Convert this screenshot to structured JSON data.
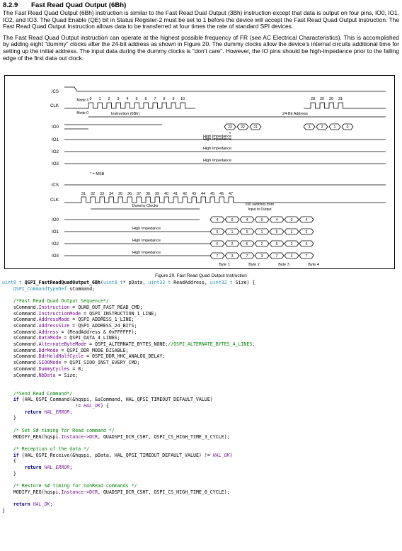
{
  "section": {
    "number": "8.2.9",
    "title": "Fast Read Quad Output (6Bh)",
    "para1": "The Fast Read Quad Output (6Bh) instruction is similar to the Fast Read Dual Output (3Bh) instruction except that data is output on four pins, IO0, IO1, IO2, and IO3. The Quad Enable (QE) bit in Status Register-2 must be set to 1 before the device will accept the Fast Read Quad Output Instruction. The Fast Read Quad Output Instruction allows data to be transferred at four times the rate of standard SPI devices.",
    "para2": "The Fast Read Quad Output instruction can operate at the highest possible frequency of FR (see AC Electrical Characteristics). This is accomplished by adding eight \"dummy\" clocks after the 24-bit address as shown in Figure 20. The dummy clocks allow the device's internal circuits additional time for setting up the initial address. The input data during the dummy clocks is \"don't care\". However, the IO pins should be high-impedance prior to the falling edge of the first data out clock."
  },
  "figure": {
    "caption": "Figure 20. Fast Read Quad Output Instruction",
    "top": {
      "signals": [
        "/CS",
        "CLK",
        "IO0",
        "IO1",
        "IO2",
        "IO3"
      ],
      "mode3": "Mode 3",
      "mode0": "Mode 0",
      "clock_numbers": [
        "0",
        "1",
        "2",
        "3",
        "4",
        "5",
        "6",
        "7",
        "8",
        "9",
        "10",
        "28",
        "29",
        "30",
        "31"
      ],
      "instruction_label": "Instruction (6Bh)",
      "address_label": "24-Bit Address",
      "address_bits": [
        "23",
        "22",
        "21",
        "3",
        "2",
        "1",
        "0"
      ],
      "high_impedance": "High Impedance",
      "msb_note": "* = MSB"
    },
    "bottom": {
      "signals": [
        "/CS",
        "CLK",
        "IO0",
        "IO1",
        "IO2",
        "IO3"
      ],
      "clock_numbers": [
        "31",
        "32",
        "33",
        "34",
        "35",
        "36",
        "37",
        "38",
        "39",
        "40",
        "41",
        "42",
        "43",
        "44",
        "45",
        "46",
        "47"
      ],
      "dummy_label": "Dummy Clocks",
      "switch_label_1": "IO0 switches from",
      "switch_label_2": "Input to Output",
      "high_impedance": "High Impedance",
      "io0_vals": [
        "4",
        "0",
        "4",
        "0",
        "4",
        "0",
        "4"
      ],
      "io1_vals": [
        "5",
        "1",
        "5",
        "1",
        "5",
        "1",
        "5"
      ],
      "io2_vals": [
        "6",
        "2",
        "6",
        "2",
        "6",
        "2",
        "6"
      ],
      "io3_vals": [
        "7",
        "3",
        "7",
        "3",
        "7",
        "3",
        "7"
      ],
      "bytes": [
        "Byte 1",
        "Byte 2",
        "Byte 3",
        "Byte 4"
      ]
    }
  },
  "code": [
    {
      "t": "uint8_t ",
      "c": "ty"
    },
    {
      "t": "QSPI_FastReadQuadOutput_6Bh",
      "c": "fn"
    },
    {
      "t": "(",
      "c": "nm"
    },
    {
      "t": "uint8_t",
      "c": "ty"
    },
    {
      "t": "* pData, ",
      "c": "nm"
    },
    {
      "t": "uint32_t",
      "c": "ty"
    },
    {
      "t": " ReadAddress, ",
      "c": "nm"
    },
    {
      "t": "uint32_t",
      "c": "ty"
    },
    {
      "t": " Size) {\n",
      "c": "nm"
    },
    {
      "t": "    ",
      "c": "nm"
    },
    {
      "t": "QSPI_CommandTypeDef",
      "c": "ty"
    },
    {
      "t": " sCommand;\n\n",
      "c": "nm"
    },
    {
      "t": "    /*Fast Read Quad Output Sequence*/\n",
      "c": "cm"
    },
    {
      "t": "    sCommand.",
      "c": "nm"
    },
    {
      "t": "Instruction",
      "c": "mem"
    },
    {
      "t": " = QUAD_OUT_FAST_READ_CMD;\n",
      "c": "nm"
    },
    {
      "t": "    sCommand.",
      "c": "nm"
    },
    {
      "t": "InstructionMode",
      "c": "mem"
    },
    {
      "t": " = QSPI_INSTRUCTION_1_LINE;\n",
      "c": "nm"
    },
    {
      "t": "    sCommand.",
      "c": "nm"
    },
    {
      "t": "AddressMode",
      "c": "mem"
    },
    {
      "t": " = QSPI_ADDRESS_1_LINE;\n",
      "c": "nm"
    },
    {
      "t": "    sCommand.",
      "c": "nm"
    },
    {
      "t": "AddressSize",
      "c": "mem"
    },
    {
      "t": " = QSPI_ADDRESS_24_BITS;\n",
      "c": "nm"
    },
    {
      "t": "    sCommand.",
      "c": "nm"
    },
    {
      "t": "Address",
      "c": "mem"
    },
    {
      "t": " = (ReadAddress & 0xFFFFFF);\n",
      "c": "nm"
    },
    {
      "t": "    sCommand.",
      "c": "nm"
    },
    {
      "t": "DataMode",
      "c": "mem"
    },
    {
      "t": " = QSPI_DATA_4_LINES;\n",
      "c": "nm"
    },
    {
      "t": "    sCommand.",
      "c": "nm"
    },
    {
      "t": "AlternateByteMode",
      "c": "mem"
    },
    {
      "t": " = QSPI_ALTERNATE_BYTES_NONE;",
      "c": "nm"
    },
    {
      "t": "//QSPI_ALTERNATE_BYTES_4_LINES;\n",
      "c": "cm"
    },
    {
      "t": "    sCommand.",
      "c": "nm"
    },
    {
      "t": "DdrMode",
      "c": "mem"
    },
    {
      "t": " = QSPI_DDR_MODE_DISABLE;\n",
      "c": "nm"
    },
    {
      "t": "    sCommand.",
      "c": "nm"
    },
    {
      "t": "DdrHoldHalfCycle",
      "c": "mem"
    },
    {
      "t": " = QSPI_DDR_HHC_ANALOG_DELAY;\n",
      "c": "nm"
    },
    {
      "t": "    sCommand.",
      "c": "nm"
    },
    {
      "t": "SIOOMode",
      "c": "mem"
    },
    {
      "t": " = QSPI_SIOO_INST_EVERY_CMD;\n",
      "c": "nm"
    },
    {
      "t": "    sCommand.",
      "c": "nm"
    },
    {
      "t": "DummyCycles",
      "c": "mem"
    },
    {
      "t": " = 8;\n",
      "c": "nm"
    },
    {
      "t": "    sCommand.",
      "c": "nm"
    },
    {
      "t": "NbData",
      "c": "mem"
    },
    {
      "t": " = Size;\n\n\n",
      "c": "nm"
    },
    {
      "t": "    /*Send Read Command*/\n",
      "c": "cm"
    },
    {
      "t": "    ",
      "c": "nm"
    },
    {
      "t": "if",
      "c": "kw"
    },
    {
      "t": " (HAL_QSPI_Command(&hqspi, &sCommand, HAL_QPSI_TIMEOUT_DEFAULT_VALUE)\n",
      "c": "nm"
    },
    {
      "t": "                          != ",
      "c": "nm"
    },
    {
      "t": "HAL_OK",
      "c": "en"
    },
    {
      "t": ") {\n",
      "c": "nm"
    },
    {
      "t": "        ",
      "c": "nm"
    },
    {
      "t": "return",
      "c": "kw"
    },
    {
      "t": " ",
      "c": "nm"
    },
    {
      "t": "HAL_ERROR",
      "c": "en"
    },
    {
      "t": ";\n",
      "c": "nm"
    },
    {
      "t": "    }\n\n",
      "c": "nm"
    },
    {
      "t": "    /* Set S# timing for Read command */\n",
      "c": "cm"
    },
    {
      "t": "    MODIFY_REG(hqspi.",
      "c": "nm"
    },
    {
      "t": "Instance",
      "c": "mem"
    },
    {
      "t": "->",
      "c": "nm"
    },
    {
      "t": "DCR",
      "c": "mem"
    },
    {
      "t": ", QUADSPI_DCR_CSHT, QSPI_CS_HIGH_TIME_3_CYCLE);\n\n",
      "c": "nm"
    },
    {
      "t": "    /* Reception of the data */\n",
      "c": "cm"
    },
    {
      "t": "    ",
      "c": "nm"
    },
    {
      "t": "if",
      "c": "kw"
    },
    {
      "t": " (HAL_QSPI_Receive(&hqspi, pData, HAL_QPSI_TIMEOUT_DEFAULT_VALUE) != ",
      "c": "nm"
    },
    {
      "t": "HAL_OK",
      "c": "en"
    },
    {
      "t": ")\n",
      "c": "nm"
    },
    {
      "t": "    {\n",
      "c": "nm"
    },
    {
      "t": "        ",
      "c": "nm"
    },
    {
      "t": "return",
      "c": "kw"
    },
    {
      "t": " ",
      "c": "nm"
    },
    {
      "t": "HAL_ERROR",
      "c": "en"
    },
    {
      "t": ";\n",
      "c": "nm"
    },
    {
      "t": "    }\n\n",
      "c": "nm"
    },
    {
      "t": "    /* Restore S# timing for nonRead commands */\n",
      "c": "cm"
    },
    {
      "t": "    MODIFY_REG(hqspi.",
      "c": "nm"
    },
    {
      "t": "Instance",
      "c": "mem"
    },
    {
      "t": "->",
      "c": "nm"
    },
    {
      "t": "DCR",
      "c": "mem"
    },
    {
      "t": ", QUADSPI_DCR_CSHT, QSPI_CS_HIGH_TIME_6_CYCLE);\n\n",
      "c": "nm"
    },
    {
      "t": "    ",
      "c": "nm"
    },
    {
      "t": "return",
      "c": "kw"
    },
    {
      "t": " ",
      "c": "nm"
    },
    {
      "t": "HAL_OK",
      "c": "en"
    },
    {
      "t": ";\n",
      "c": "nm"
    },
    {
      "t": "}",
      "c": "nm"
    }
  ]
}
